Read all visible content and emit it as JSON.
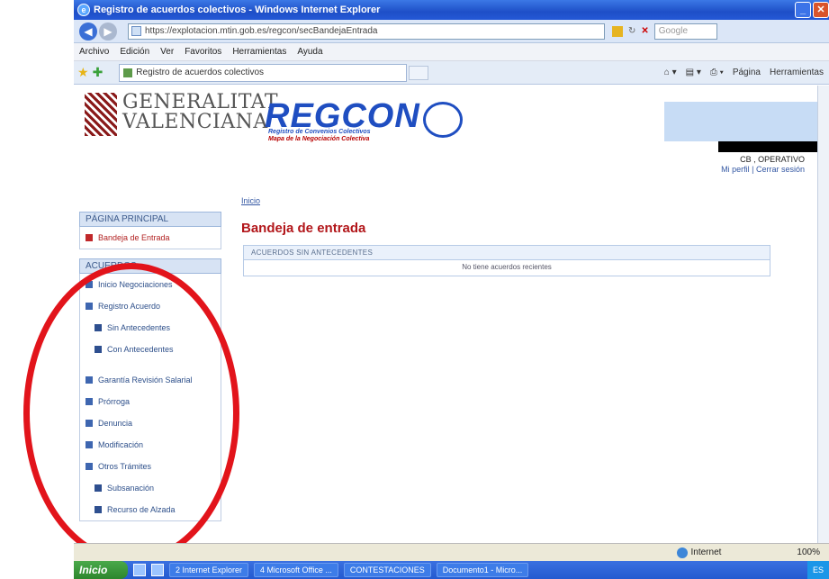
{
  "window": {
    "title": "Registro de acuerdos colectivos - Windows Internet Explorer",
    "url": "https://explotacion.mtin.gob.es/regcon/secBandejaEntrada",
    "search_placeholder": "Google",
    "menu": [
      "Archivo",
      "Edición",
      "Ver",
      "Favoritos",
      "Herramientas",
      "Ayuda"
    ],
    "tab_label": "Registro de acuerdos colectivos",
    "cmd_items": [
      "Página",
      "Herramientas"
    ]
  },
  "header": {
    "gv_line1": "GENERALITAT",
    "gv_line2": "VALENCIANA",
    "regcon": "REGCON",
    "regcon_sub1": "Registro de Convenios Colectivos",
    "regcon_sub2": "Mapa de la Negociación Colectiva",
    "user_role": "CB , OPERATIVO",
    "profile_link": "Mi perfil",
    "logout_link": "Cerrar sesión"
  },
  "breadcrumb": "Inicio",
  "sidebar": {
    "section_main": "PÁGINA PRINCIPAL",
    "inbox": "Bandeja de Entrada",
    "section_agreements": "ACUERDOS",
    "items": [
      {
        "label": "Inicio Negociaciones",
        "sub": false
      },
      {
        "label": "Registro Acuerdo",
        "sub": false
      },
      {
        "label": "Sin Antecedentes",
        "sub": true
      },
      {
        "label": "Con Antecedentes",
        "sub": true
      }
    ],
    "items2": [
      {
        "label": "Garantía Revisión Salarial",
        "sub": false
      },
      {
        "label": "Prórroga",
        "sub": false
      },
      {
        "label": "Denuncia",
        "sub": false
      },
      {
        "label": "Modificación",
        "sub": false
      },
      {
        "label": "Otros Trámites",
        "sub": false
      },
      {
        "label": "Subsanación",
        "sub": true
      },
      {
        "label": "Recurso de Alzada",
        "sub": true
      }
    ]
  },
  "main": {
    "title": "Bandeja de entrada",
    "table_header": "ACUERDOS SIN ANTECEDENTES",
    "empty_message": "No tiene acuerdos recientes"
  },
  "status": {
    "zone": "Internet",
    "zoom": "100%"
  },
  "taskbar": {
    "start": "Inicio",
    "tasks": [
      "2 Internet Explorer",
      "4 Microsoft Office ...",
      "CONTESTACIONES",
      "Documento1 - Micro..."
    ],
    "tray": "ES"
  },
  "colors": {
    "accent_red": "#b2161a",
    "brand_blue": "#1f4ec1",
    "annotation_circle": "#e2141b"
  }
}
